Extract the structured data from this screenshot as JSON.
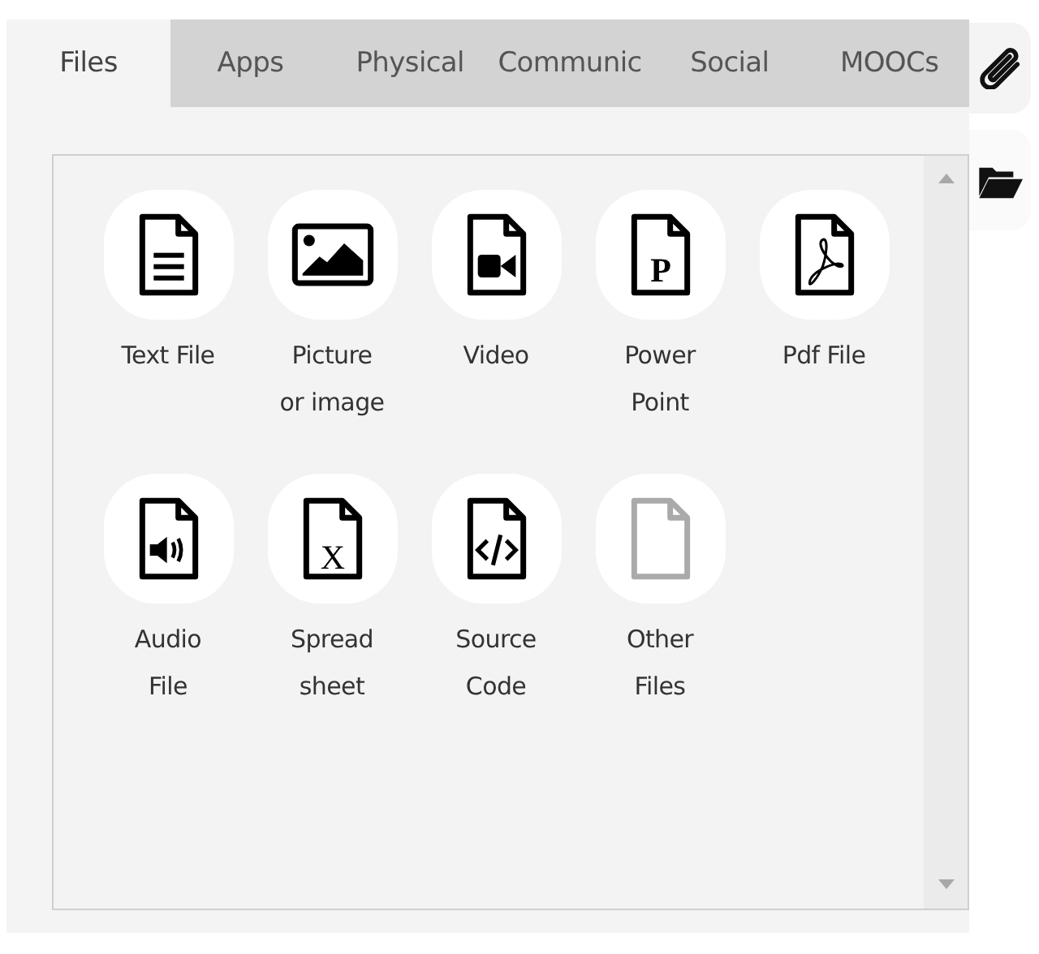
{
  "tabs": [
    {
      "label": "Files",
      "selected": true
    },
    {
      "label": "Apps",
      "selected": false
    },
    {
      "label": "Physical",
      "selected": false
    },
    {
      "label": "Communic",
      "selected": false
    },
    {
      "label": "Social",
      "selected": false
    },
    {
      "label": "MOOCs",
      "selected": false
    }
  ],
  "side_tabs": [
    {
      "kind": "attachment",
      "selected": false
    },
    {
      "kind": "folder",
      "selected": true
    }
  ],
  "items": [
    {
      "kind": "text",
      "lines": [
        "Text File"
      ]
    },
    {
      "kind": "image",
      "lines": [
        "Picture",
        "or image"
      ]
    },
    {
      "kind": "video",
      "lines": [
        "Video"
      ]
    },
    {
      "kind": "presentation",
      "glyph": "P",
      "lines": [
        "Power",
        "Point"
      ]
    },
    {
      "kind": "pdf",
      "lines": [
        "Pdf File"
      ]
    },
    {
      "kind": "audio",
      "lines": [
        "Audio",
        "File"
      ]
    },
    {
      "kind": "spreadsheet",
      "glyph": "X",
      "lines": [
        "Spread",
        "sheet"
      ]
    },
    {
      "kind": "code",
      "lines": [
        "Source",
        "Code"
      ]
    },
    {
      "kind": "other",
      "lines": [
        "Other",
        "Files"
      ]
    }
  ]
}
